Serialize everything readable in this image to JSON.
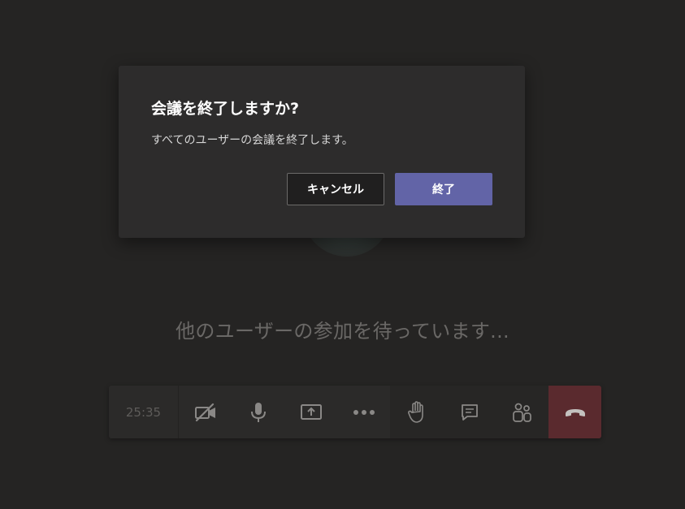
{
  "dialog": {
    "title": "会議を終了しますか?",
    "message": "すべてのユーザーの会議を終了します。",
    "cancel_label": "キャンセル",
    "end_label": "終了"
  },
  "stage": {
    "waiting_text": "他のユーザーの参加を待っています..."
  },
  "callbar": {
    "timer": "25:35",
    "controls": [
      {
        "name": "camera-off-icon"
      },
      {
        "name": "microphone-icon"
      },
      {
        "name": "share-screen-icon"
      },
      {
        "name": "more-options-icon"
      },
      {
        "name": "raise-hand-icon"
      },
      {
        "name": "chat-icon"
      },
      {
        "name": "participants-icon"
      },
      {
        "name": "hang-up-icon"
      }
    ]
  },
  "colors": {
    "background": "#252423",
    "dialog": "#2d2c2c",
    "primary": "#6264a7",
    "hangup": "#5a2a2e",
    "bar": "#2b2a29"
  }
}
